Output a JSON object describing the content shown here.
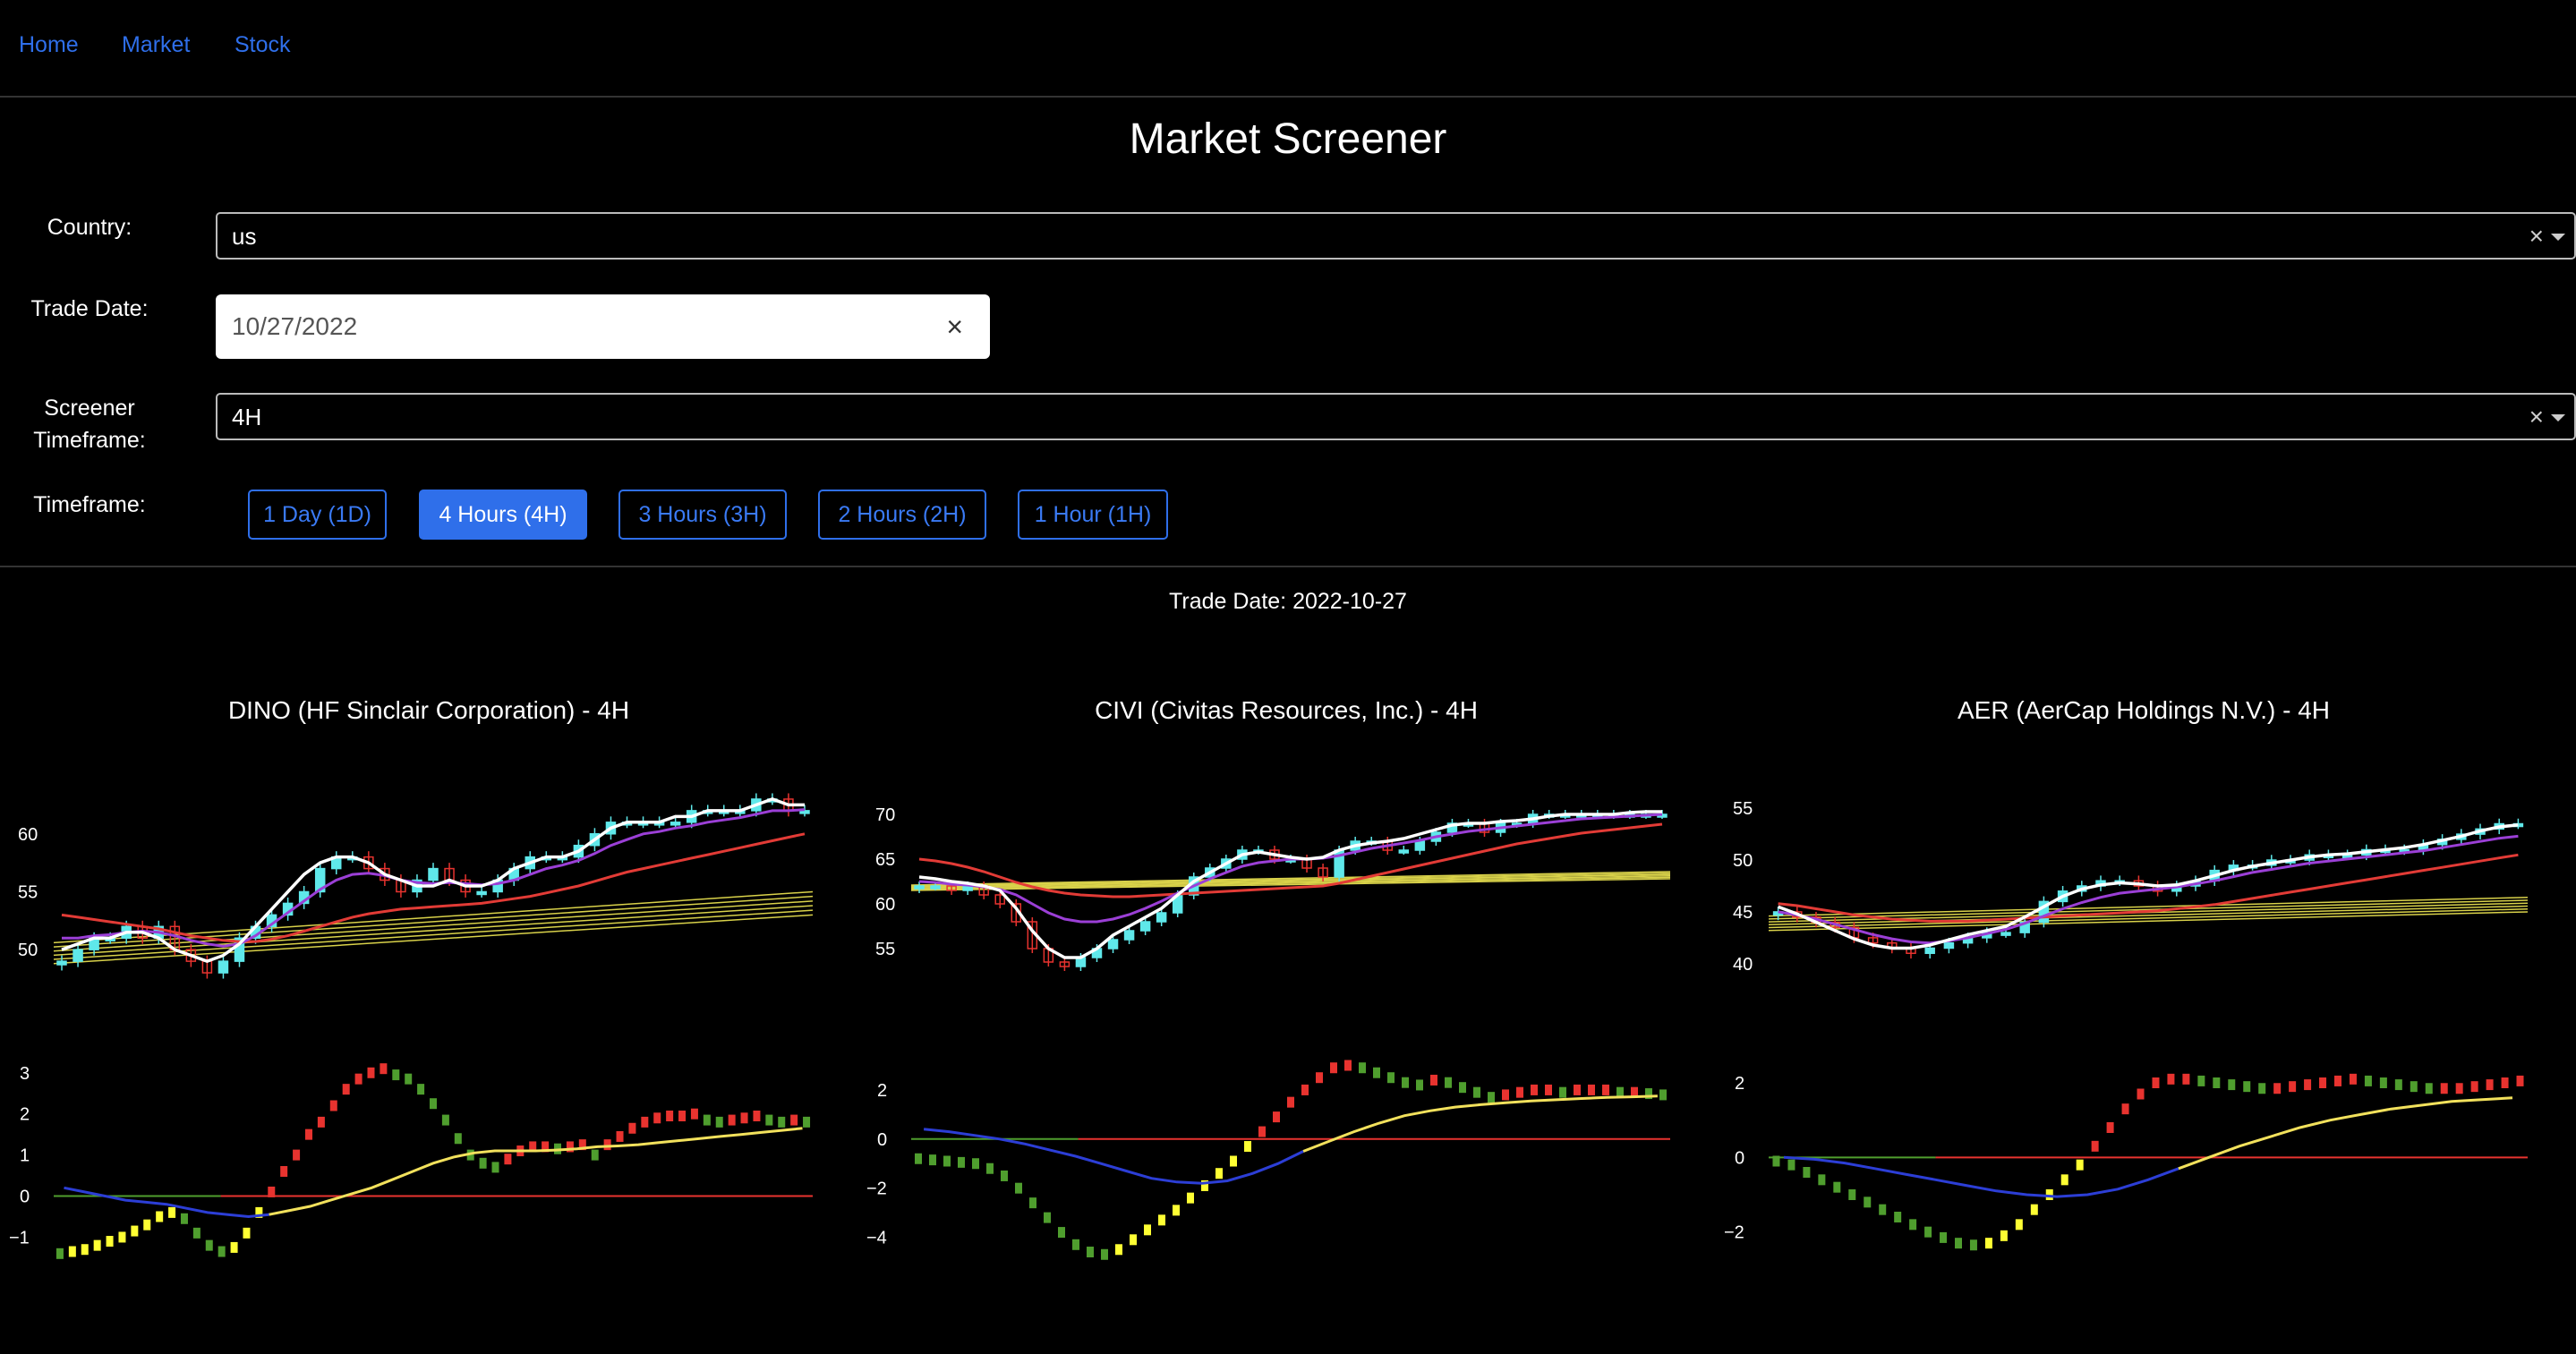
{
  "nav": {
    "home": "Home",
    "market": "Market",
    "stock": "Stock"
  },
  "page_title": "Market Screener",
  "filters": {
    "country_label": "Country:",
    "country_value": "us",
    "trade_date_label": "Trade Date:",
    "trade_date_value": "10/27/2022",
    "screener_tf_label_1": "Screener",
    "screener_tf_label_2": "Timeframe:",
    "screener_tf_value": "4H",
    "timeframe_label": "Timeframe:",
    "clear_glyph": "×"
  },
  "timeframes": [
    "1 Day (1D)",
    "4 Hours (4H)",
    "3 Hours (3H)",
    "2 Hours (2H)",
    "1 Hour (1H)"
  ],
  "active_timeframe": "4 Hours (4H)",
  "trade_date_header": "Trade Date: 2022-10-27",
  "colors": {
    "accent": "#2f6fea",
    "up": "#5fe8ea",
    "down": "#e8332f",
    "ma_fast": "#ffffff",
    "ma_mid": "#9b3fd6",
    "ma_slow": "#e23b36",
    "ma_long": "#d9d24a",
    "hist_green": "#4f9e2e",
    "hist_red": "#e8332f",
    "hist_yellow": "#ffff33",
    "signal": "#f2e15c",
    "zero_low": "#2c3ed6"
  },
  "chart_data": [
    {
      "type": "candlestick",
      "title": "DINO (HF Sinclair Corporation) - 4H",
      "price_ticks": [
        50,
        55,
        60
      ],
      "price_range": [
        47,
        64
      ],
      "close": [
        49,
        50,
        51,
        51,
        52,
        51,
        52,
        50,
        49,
        48,
        49,
        51,
        52,
        53,
        54,
        55,
        57,
        58,
        58,
        57,
        56,
        55,
        56,
        57,
        56,
        55,
        55,
        56,
        57,
        58,
        58,
        58,
        59,
        60,
        61,
        61,
        61,
        61,
        61,
        62,
        62,
        62,
        62,
        63,
        63,
        62,
        62
      ],
      "ma_fast": [
        50,
        50.5,
        51,
        51,
        51.5,
        51.5,
        51,
        50,
        49.5,
        49,
        49.5,
        50.5,
        52,
        53.5,
        55,
        56.5,
        57.5,
        58,
        58,
        57.5,
        56.5,
        56,
        55.5,
        55.5,
        56,
        55.5,
        55.5,
        56,
        57,
        57.5,
        58,
        58,
        58.5,
        59.5,
        60.5,
        61,
        61,
        61,
        61.5,
        61.5,
        62,
        62,
        62,
        62.5,
        63,
        62.5,
        62.5
      ],
      "ma_mid": [
        51,
        51,
        51.2,
        51.3,
        51.5,
        51.6,
        51.5,
        51.2,
        50.8,
        50.5,
        50.3,
        50.5,
        51.2,
        52.2,
        53.2,
        54.2,
        55.2,
        56,
        56.5,
        56.6,
        56.4,
        56,
        55.8,
        55.7,
        55.8,
        55.7,
        55.6,
        55.7,
        56,
        56.5,
        57,
        57.3,
        57.7,
        58.3,
        59,
        59.5,
        60,
        60.2,
        60.5,
        60.7,
        61,
        61.2,
        61.4,
        61.7,
        62,
        62,
        62.1
      ],
      "ma_slow": [
        53,
        52.8,
        52.6,
        52.4,
        52.2,
        52,
        51.8,
        51.5,
        51.2,
        51,
        50.8,
        50.7,
        50.7,
        50.9,
        51.2,
        51.6,
        52,
        52.4,
        52.8,
        53.1,
        53.3,
        53.5,
        53.6,
        53.7,
        53.8,
        53.9,
        54,
        54.2,
        54.4,
        54.6,
        54.9,
        55.2,
        55.5,
        55.9,
        56.3,
        56.7,
        57,
        57.3,
        57.6,
        57.9,
        58.2,
        58.5,
        58.8,
        59.1,
        59.4,
        59.7,
        60
      ],
      "ma_long_start": [
        48.8,
        50.6
      ],
      "ma_long_end": [
        53,
        55
      ],
      "osc_ticks": [
        -1,
        0,
        1,
        2,
        3
      ],
      "osc_range": [
        -1.6,
        3.3
      ],
      "hist": [
        -1.4,
        -1.35,
        -1.3,
        -1.2,
        -1.1,
        -1,
        -0.85,
        -0.7,
        -0.5,
        -0.4,
        -0.55,
        -0.9,
        -1.2,
        -1.35,
        -1.25,
        -0.9,
        -0.4,
        0.1,
        0.6,
        1.0,
        1.5,
        1.8,
        2.2,
        2.6,
        2.85,
        3.0,
        3.1,
        2.95,
        2.85,
        2.6,
        2.25,
        1.85,
        1.4,
        1.0,
        0.8,
        0.7,
        0.9,
        1.1,
        1.2,
        1.2,
        1.15,
        1.2,
        1.25,
        1.0,
        1.25,
        1.45,
        1.65,
        1.8,
        1.9,
        1.95,
        1.95,
        2.0,
        1.85,
        1.8,
        1.85,
        1.9,
        1.95,
        1.85,
        1.8,
        1.85,
        1.8
      ],
      "signal": [
        0.2,
        0.1,
        0.0,
        -0.1,
        -0.15,
        -0.2,
        -0.3,
        -0.4,
        -0.45,
        -0.5,
        -0.45,
        -0.35,
        -0.25,
        -0.1,
        0.05,
        0.2,
        0.4,
        0.6,
        0.8,
        0.95,
        1.05,
        1.1,
        1.1,
        1.1,
        1.12,
        1.15,
        1.2,
        1.22,
        1.25,
        1.3,
        1.35,
        1.4,
        1.45,
        1.5,
        1.55,
        1.6,
        1.65
      ]
    },
    {
      "type": "candlestick",
      "title": "CIVI (Civitas Resources, Inc.) - 4H",
      "price_ticks": [
        55,
        60,
        65,
        70
      ],
      "price_range": [
        51,
        73
      ],
      "close": [
        62,
        62,
        61.5,
        62,
        61,
        60,
        58,
        55,
        53.5,
        53,
        54,
        55,
        56,
        57,
        58,
        59,
        61,
        63,
        64,
        65,
        66,
        66,
        65,
        65,
        64,
        63,
        66,
        67,
        67,
        66,
        66,
        67,
        68,
        69,
        69,
        68,
        69,
        69,
        70,
        70,
        70,
        70,
        70,
        70,
        70,
        70,
        70
      ],
      "ma_fast": [
        63,
        62.8,
        62.5,
        62.3,
        62,
        61.5,
        59.5,
        57,
        55,
        54,
        54,
        55,
        56.5,
        57.5,
        58.5,
        59.5,
        61,
        62.5,
        63.5,
        64.5,
        65.5,
        65.8,
        65.5,
        65.2,
        65,
        65.2,
        66,
        66.5,
        66.8,
        67,
        67.3,
        67.8,
        68.3,
        68.8,
        69,
        69,
        69.2,
        69.3,
        69.5,
        69.8,
        70,
        70,
        70,
        70,
        70.2,
        70.3,
        70.3
      ],
      "ma_mid": [
        62.5,
        62.4,
        62.2,
        62.1,
        61.9,
        61.6,
        61,
        60,
        59,
        58.3,
        58,
        58,
        58.3,
        58.8,
        59.5,
        60.3,
        61.2,
        62,
        62.8,
        63.5,
        64.2,
        64.6,
        64.8,
        65,
        65,
        65.1,
        65.4,
        65.8,
        66.2,
        66.5,
        66.8,
        67.1,
        67.5,
        67.8,
        68.1,
        68.3,
        68.5,
        68.7,
        68.9,
        69.1,
        69.3,
        69.5,
        69.6,
        69.7,
        69.8,
        69.9,
        70
      ],
      "ma_slow": [
        65,
        64.8,
        64.5,
        64.1,
        63.6,
        63,
        62.4,
        61.9,
        61.5,
        61.2,
        61,
        60.9,
        60.8,
        60.8,
        60.9,
        61,
        61.1,
        61.2,
        61.3,
        61.4,
        61.5,
        61.6,
        61.7,
        61.8,
        61.9,
        62,
        62.3,
        62.7,
        63.1,
        63.5,
        63.9,
        64.3,
        64.7,
        65.1,
        65.5,
        65.9,
        66.3,
        66.7,
        67,
        67.3,
        67.6,
        67.9,
        68.1,
        68.3,
        68.5,
        68.7,
        68.9
      ],
      "ma_long_start": [
        61.5,
        62.1
      ],
      "ma_long_end": [
        62.8,
        63.6
      ],
      "osc_ticks": [
        -4,
        2,
        0,
        -2
      ],
      "osc_range": [
        -5.0,
        3.2
      ],
      "hist": [
        -0.8,
        -0.85,
        -0.9,
        -0.95,
        -1.0,
        -1.2,
        -1.5,
        -2.0,
        -2.6,
        -3.2,
        -3.8,
        -4.3,
        -4.6,
        -4.7,
        -4.5,
        -4.1,
        -3.7,
        -3.3,
        -2.9,
        -2.4,
        -1.9,
        -1.4,
        -0.9,
        -0.3,
        0.3,
        0.9,
        1.5,
        2.0,
        2.5,
        2.9,
        3.0,
        2.9,
        2.7,
        2.5,
        2.3,
        2.2,
        2.4,
        2.3,
        2.1,
        1.9,
        1.7,
        1.8,
        1.9,
        2.0,
        2.0,
        1.9,
        2.0,
        2.0,
        2.0,
        1.9,
        1.9,
        1.85,
        1.8
      ],
      "signal": [
        0.4,
        0.3,
        0.15,
        0.0,
        -0.2,
        -0.45,
        -0.7,
        -1.0,
        -1.3,
        -1.6,
        -1.75,
        -1.8,
        -1.7,
        -1.4,
        -1.0,
        -0.5,
        -0.1,
        0.3,
        0.65,
        0.95,
        1.15,
        1.3,
        1.4,
        1.48,
        1.55,
        1.6,
        1.65,
        1.7,
        1.72,
        1.75
      ]
    },
    {
      "type": "candlestick",
      "title": "AER (AerCap Holdings N.V.) - 4H",
      "price_ticks": [
        40,
        45,
        50,
        55
      ],
      "price_range": [
        38,
        57
      ],
      "close": [
        45,
        44.5,
        44,
        43.5,
        42.5,
        42,
        41.5,
        41,
        41.5,
        42,
        42.5,
        43,
        43,
        44,
        46,
        47,
        47.5,
        48,
        48,
        47.5,
        47,
        47.5,
        48,
        49,
        49.5,
        49.5,
        50,
        50,
        50.5,
        50.5,
        50.5,
        51,
        51,
        51,
        51.5,
        52,
        52.5,
        53,
        53.5,
        53.5
      ],
      "ma_fast": [
        45.5,
        44.8,
        44,
        43.2,
        42.4,
        41.8,
        41.5,
        41.5,
        41.8,
        42.3,
        42.8,
        43.2,
        43.6,
        44.5,
        45.5,
        46.5,
        47.2,
        47.6,
        47.8,
        47.7,
        47.5,
        47.6,
        48,
        48.5,
        49,
        49.4,
        49.7,
        50,
        50.3,
        50.5,
        50.6,
        50.8,
        51,
        51.2,
        51.5,
        51.9,
        52.3,
        52.8,
        53.2,
        53.4
      ],
      "ma_mid": [
        45,
        44.7,
        44.3,
        43.8,
        43.3,
        42.8,
        42.4,
        42.1,
        42,
        42.2,
        42.5,
        42.9,
        43.3,
        43.9,
        44.6,
        45.3,
        45.9,
        46.4,
        46.8,
        47,
        47.2,
        47.4,
        47.7,
        48,
        48.4,
        48.8,
        49.1,
        49.4,
        49.7,
        49.9,
        50.1,
        50.3,
        50.5,
        50.7,
        50.9,
        51.2,
        51.5,
        51.8,
        52.1,
        52.3
      ],
      "ma_slow": [
        45.8,
        45.6,
        45.3,
        45,
        44.7,
        44.5,
        44.3,
        44.2,
        44.1,
        44.1,
        44.1,
        44.2,
        44.3,
        44.4,
        44.5,
        44.6,
        44.7,
        44.8,
        44.9,
        45,
        45.1,
        45.3,
        45.5,
        45.7,
        46,
        46.3,
        46.6,
        46.9,
        47.2,
        47.5,
        47.8,
        48.1,
        48.4,
        48.7,
        49,
        49.3,
        49.6,
        49.9,
        50.2,
        50.5
      ],
      "ma_long_start": [
        43.2,
        44.6
      ],
      "ma_long_end": [
        45,
        46.4
      ],
      "osc_ticks": [
        -2,
        0,
        2
      ],
      "osc_range": [
        -2.8,
        2.6
      ],
      "hist": [
        -0.1,
        -0.2,
        -0.4,
        -0.6,
        -0.8,
        -1.0,
        -1.2,
        -1.4,
        -1.6,
        -1.8,
        -2.0,
        -2.15,
        -2.3,
        -2.35,
        -2.3,
        -2.1,
        -1.8,
        -1.4,
        -1.0,
        -0.6,
        -0.2,
        0.3,
        0.8,
        1.3,
        1.7,
        2.0,
        2.1,
        2.1,
        2.05,
        2.0,
        1.95,
        1.9,
        1.85,
        1.85,
        1.9,
        1.95,
        2.0,
        2.05,
        2.1,
        2.05,
        2.0,
        1.95,
        1.9,
        1.85,
        1.85,
        1.85,
        1.9,
        1.95,
        2.0,
        2.05
      ],
      "signal": [
        0,
        -0.05,
        -0.15,
        -0.3,
        -0.45,
        -0.6,
        -0.75,
        -0.9,
        -1.0,
        -1.05,
        -1.0,
        -0.85,
        -0.6,
        -0.3,
        0.0,
        0.3,
        0.55,
        0.8,
        1.0,
        1.15,
        1.3,
        1.4,
        1.5,
        1.55,
        1.6
      ]
    }
  ]
}
